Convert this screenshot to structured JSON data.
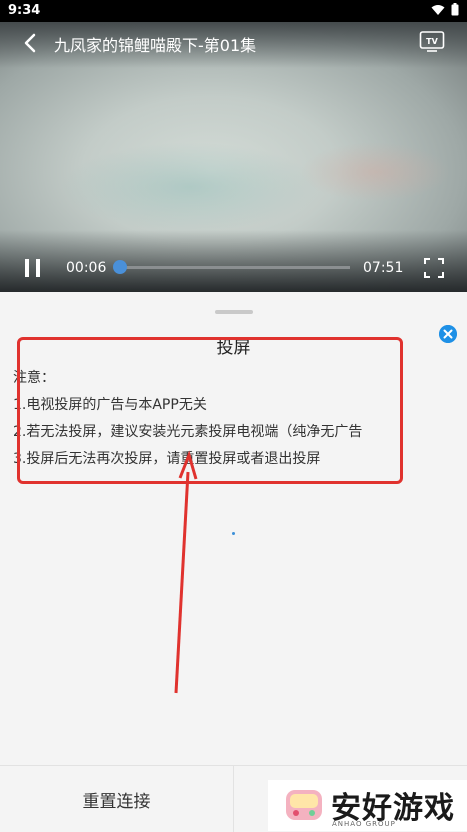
{
  "status_bar": {
    "time": "9:34"
  },
  "player": {
    "title": "九凤家的锦鲤喵殿下-第01集",
    "current_time": "00:06",
    "total_time": "07:51",
    "progress_fraction": 0.013
  },
  "sheet": {
    "title": "投屏",
    "notice_heading": "注意：",
    "notice_lines": [
      "1.电视投屏的广告与本APP无关",
      "2.若无法投屏，建议安装光元素投屏电视端（纯净无广告",
      "3.投屏后无法再次投屏，请重置投屏或者退出投屏"
    ]
  },
  "footer": {
    "reconnect_label": "重置连接"
  },
  "watermark": {
    "text": "安好游戏",
    "subtext": "ANHAO GROUP"
  },
  "colors": {
    "accent": "#1e90e6",
    "annotation": "#e0322e"
  }
}
